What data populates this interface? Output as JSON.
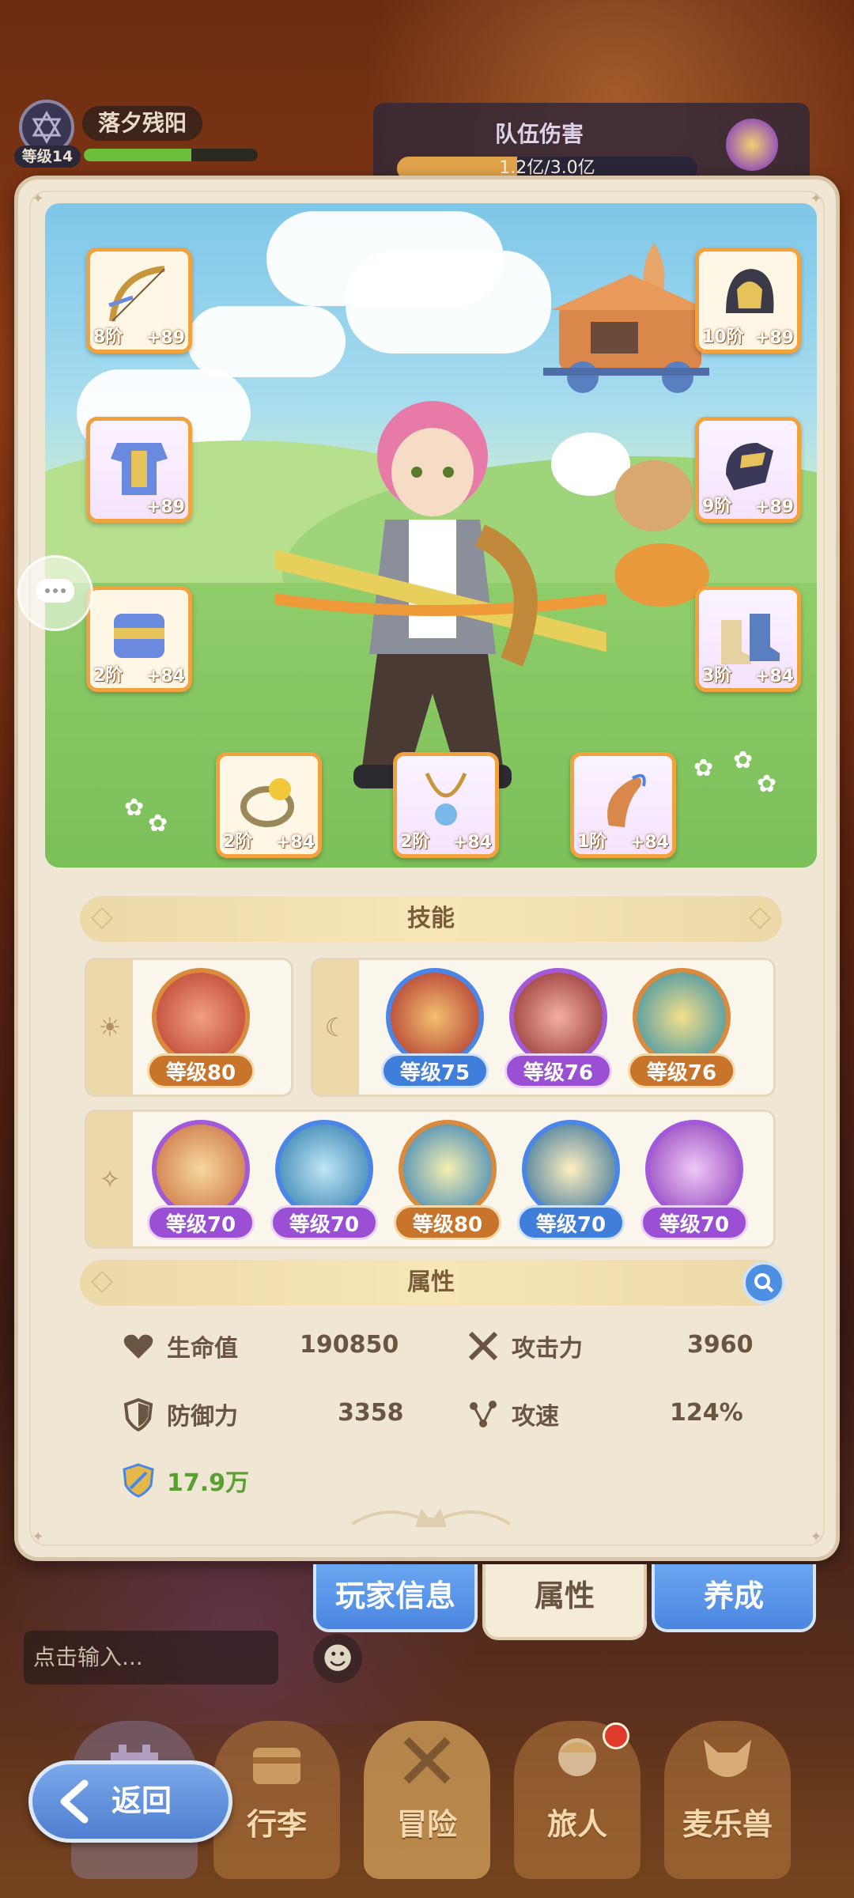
{
  "player": {
    "name": "落夕残阳",
    "level_label": "等级14",
    "xp_fraction": 0.62
  },
  "team_damage": {
    "label": "队伍伤害",
    "value": "1.2亿/3.0亿",
    "progress": 0.4
  },
  "equipment": [
    {
      "slot": "bow",
      "tier": "8阶",
      "bonus": "+89",
      "rarity": "gold"
    },
    {
      "slot": "helmet",
      "tier": "10阶",
      "bonus": "+89",
      "rarity": "gold"
    },
    {
      "slot": "armor",
      "tier": "",
      "bonus": "+89",
      "rarity": "purple"
    },
    {
      "slot": "gloves",
      "tier": "9阶",
      "bonus": "+89",
      "rarity": "purple"
    },
    {
      "slot": "belt",
      "tier": "2阶",
      "bonus": "+84",
      "rarity": "gold"
    },
    {
      "slot": "boots",
      "tier": "3阶",
      "bonus": "+84",
      "rarity": "purple"
    },
    {
      "slot": "ring",
      "tier": "2阶",
      "bonus": "+84",
      "rarity": "gold"
    },
    {
      "slot": "necklace",
      "tier": "2阶",
      "bonus": "+84",
      "rarity": "purple"
    },
    {
      "slot": "horn",
      "tier": "1阶",
      "bonus": "+84",
      "rarity": "purple"
    }
  ],
  "skills_section": {
    "title": "技能",
    "row1_left": [
      {
        "level": "等级80",
        "color": "orange"
      }
    ],
    "row1_right": [
      {
        "level": "等级75",
        "color": "blue"
      },
      {
        "level": "等级76",
        "color": "purple"
      },
      {
        "level": "等级76",
        "color": "orange"
      }
    ],
    "row2": [
      {
        "level": "等级70",
        "color": "purple"
      },
      {
        "level": "等级70",
        "color": "purple"
      },
      {
        "level": "等级80",
        "color": "orange"
      },
      {
        "level": "等级70",
        "color": "blue"
      },
      {
        "level": "等级70",
        "color": "purple"
      }
    ]
  },
  "attributes_section": {
    "title": "属性",
    "hp": {
      "label": "生命值",
      "value": "190850"
    },
    "attack": {
      "label": "攻击力",
      "value": "3960"
    },
    "defense": {
      "label": "防御力",
      "value": "3358"
    },
    "attack_speed": {
      "label": "攻速",
      "value": "124%"
    },
    "power": {
      "value": "17.9万"
    }
  },
  "tabs": [
    {
      "label": "玩家信息",
      "active": false
    },
    {
      "label": "属性",
      "active": true
    },
    {
      "label": "养成",
      "active": false
    }
  ],
  "chat": {
    "placeholder": "点击输入..."
  },
  "bottom_nav": [
    {
      "label": "行李"
    },
    {
      "label": "冒险"
    },
    {
      "label": "旅人",
      "badge": true
    },
    {
      "label": "麦乐兽"
    }
  ],
  "back_button": {
    "label": "返回"
  },
  "colors": {
    "accent_orange": "#d98a3c",
    "accent_blue": "#4a86e8",
    "accent_purple": "#a35ad9",
    "power_green": "#58a030"
  }
}
